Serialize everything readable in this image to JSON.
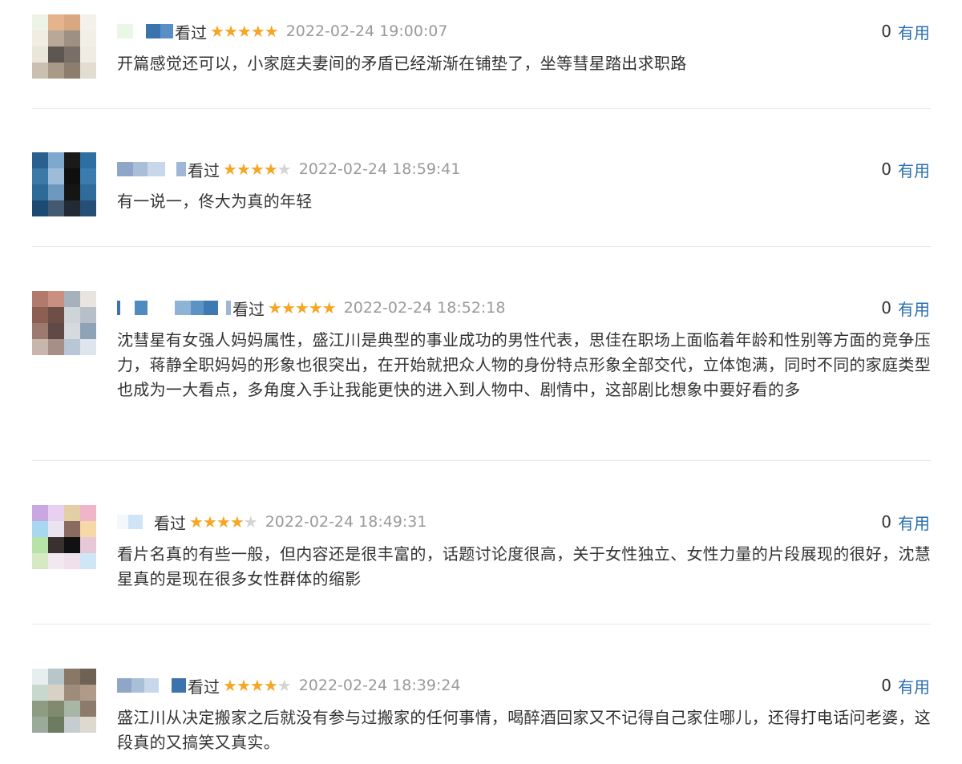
{
  "colors": {
    "star": "#f5a623",
    "star_empty": "#d4d4d4",
    "link": "#2a6fb0",
    "time": "#9a9a9a"
  },
  "comments": [
    {
      "watched": "看过",
      "rating": 5,
      "time": "2022-02-24 19:00:07",
      "useful_count": "0",
      "useful_label": "有用",
      "text": "开篇感觉还可以，小家庭夫妻间的矛盾已经渐渐在铺垫了，坐等彗星踏出求职路"
    },
    {
      "watched": "看过",
      "rating": 4,
      "time": "2022-02-24 18:59:41",
      "useful_count": "0",
      "useful_label": "有用",
      "text": "有一说一，佟大为真的年轻"
    },
    {
      "watched": "看过",
      "rating": 5,
      "time": "2022-02-24 18:52:18",
      "useful_count": "0",
      "useful_label": "有用",
      "text": "沈彗星有女强人妈妈属性，盛江川是典型的事业成功的男性代表，思佳在职场上面临着年龄和性别等方面的竞争压力，蒋静全职妈妈的形象也很突出，在开始就把众人物的身份特点形象全部交代，立体饱满，同时不同的家庭类型也成为一大看点，多角度入手让我能更快的进入到人物中、剧情中，这部剧比想象中要好看的多"
    },
    {
      "watched": "看过",
      "rating": 4,
      "time": "2022-02-24 18:49:31",
      "useful_count": "0",
      "useful_label": "有用",
      "text": "看片名真的有些一般，但内容还是很丰富的，话题讨论度很高，关于女性独立、女性力量的片段展现的很好，沈慧星真的是现在很多女性群体的缩影"
    },
    {
      "watched": "看过",
      "rating": 4,
      "time": "2022-02-24 18:39:24",
      "useful_count": "0",
      "useful_label": "有用",
      "text": "盛江川从决定搬家之后就没有参与过搬家的任何事情，喝醉酒回家又不记得自己家住哪儿，还得打电话问老婆，这段真的又搞笑又真实。"
    }
  ]
}
